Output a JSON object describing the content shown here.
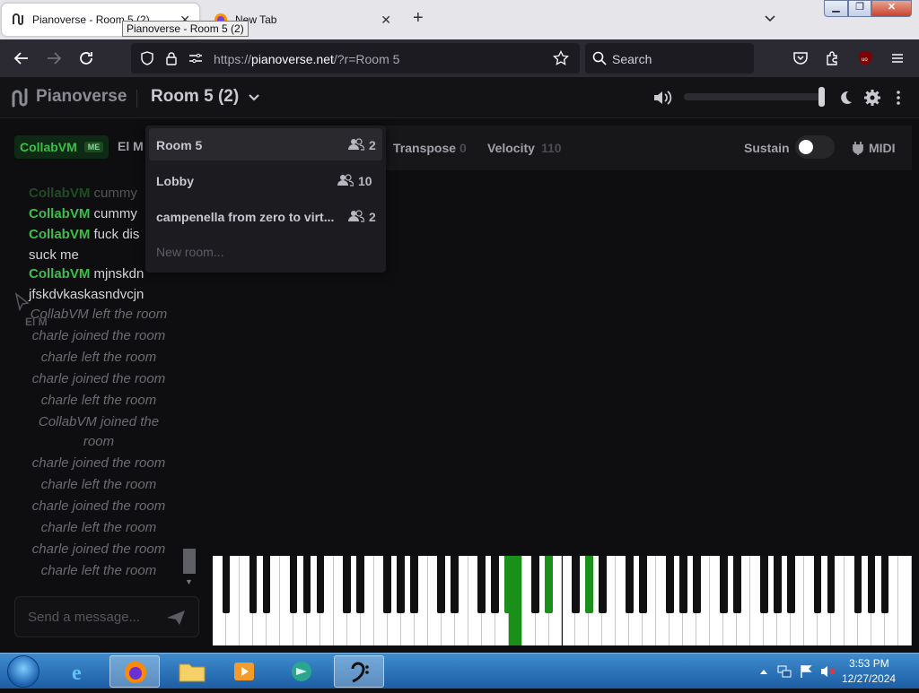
{
  "browser": {
    "tabs": [
      {
        "label": "Pianoverse - Room 5 (2)",
        "active": true
      },
      {
        "label": "New Tab",
        "active": false
      }
    ],
    "tooltip": "Pianoverse - Room 5 (2)",
    "url": {
      "prefix": "https://",
      "host": "pianoverse.net",
      "rest": "/?r=Room 5"
    },
    "search_placeholder": "Search"
  },
  "app": {
    "name": "Pianoverse",
    "room_title": "Room 5 (2)",
    "volume_level": 1.0,
    "toolbar": {
      "users": [
        {
          "name": "CollabVM",
          "badge": "ME",
          "color": "#3bbf4a"
        },
        {
          "name": "El M"
        }
      ],
      "transpose_label": "Transpose",
      "transpose_value": "0",
      "velocity_label": "Velocity",
      "velocity_value": "110",
      "sustain_label": "Sustain",
      "sustain_on": false,
      "midi_label": "MIDI"
    },
    "room_menu": {
      "items": [
        {
          "name": "Room 5",
          "count": "2",
          "selected": true
        },
        {
          "name": "Lobby",
          "count": "10",
          "selected": false
        },
        {
          "name": "campenella from zero to virt...",
          "count": "2",
          "selected": false
        }
      ],
      "new_room": "New room..."
    },
    "chat": {
      "messages": [
        {
          "who": "CollabVM",
          "text": "cummy"
        },
        {
          "who": "CollabVM",
          "text": "cummy"
        },
        {
          "who": "CollabVM",
          "text": "fuck dis suck me"
        },
        {
          "who": "CollabVM",
          "text": "mjnskdn jfskdvkaskasndvcjn"
        }
      ],
      "system": [
        "CollabVM left the room",
        "charle joined the room",
        "charle left the room",
        "charle joined the room",
        "charle left the room",
        "CollabVM joined the room",
        "charle joined the room",
        "charle left the room",
        "charle joined the room",
        "charle left the room",
        "charle joined the room",
        "charle left the room"
      ],
      "ghost_cursor_label": "El M",
      "input_placeholder": "Send a message..."
    },
    "piano": {
      "pressed_white_keys": [
        22
      ],
      "pressed_black_keys": [
        15,
        17,
        19
      ],
      "pressed_color": "#1a8f1a"
    }
  },
  "taskbar": {
    "time": "3:53 PM",
    "date": "12/27/2024"
  }
}
